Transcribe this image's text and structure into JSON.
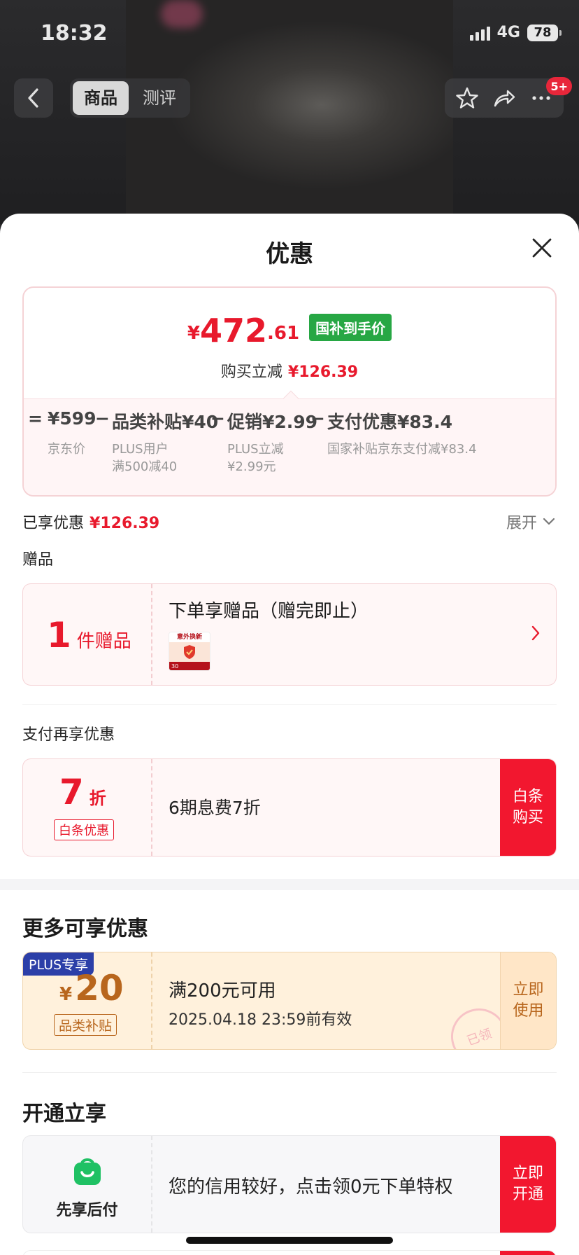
{
  "status": {
    "time": "18:32",
    "network": "4G",
    "battery": "78"
  },
  "nav": {
    "tabs": [
      {
        "label": "商品"
      },
      {
        "label": "测评"
      }
    ],
    "badge": "5+"
  },
  "sheet": {
    "title": "优惠"
  },
  "price": {
    "currency": "¥",
    "integer": "472",
    "decimal": ".61",
    "tag": "国补到手价",
    "reduce_label": "购买立减",
    "reduce_value": "¥126.39"
  },
  "breakdown": {
    "eq": "=",
    "items": [
      {
        "value": "¥599",
        "sub1": "京东价",
        "sub2": ""
      },
      {
        "op": "−",
        "value": "品类补贴¥40",
        "sub1": "PLUS用户",
        "sub2": "满500减40"
      },
      {
        "op": "−",
        "value": "促销¥2.99",
        "sub1": "PLUS立减",
        "sub2": "¥2.99元"
      },
      {
        "op": "−",
        "value": "支付优惠¥83.4",
        "sub1": "国家补贴京东支付减¥83.4",
        "sub2": ""
      }
    ]
  },
  "enjoyed": {
    "label": "已享优惠",
    "value": "¥126.39",
    "expand": "展开"
  },
  "gift": {
    "section": "赠品",
    "count": "1",
    "count_unit": "件赠品",
    "title": "下单享赠品（赠完即止）",
    "thumb_top": "意外换新",
    "thumb_bottom": "30"
  },
  "pay": {
    "section": "支付再享优惠",
    "num": "7",
    "unit": "折",
    "tag": "白条优惠",
    "text": "6期息费7折",
    "button": [
      "白条",
      "购买"
    ]
  },
  "more": {
    "section": "更多可享优惠",
    "plus_tag": "PLUS专享",
    "currency": "¥",
    "amount": "20",
    "tag": "品类补贴",
    "line1": "满200元可用",
    "line2": "2025.04.18 23:59前有效",
    "button": [
      "立即",
      "使用"
    ],
    "stamp": "已领"
  },
  "open": {
    "section": "开通立享",
    "label": "先享后付",
    "text": "您的信用较好，点击领0元下单特权",
    "button": [
      "立即",
      "开通"
    ]
  },
  "colors": {
    "accent": "#e8192c",
    "green": "#27a744",
    "plus": "#2c3fa8",
    "gold": "#b8661d"
  }
}
